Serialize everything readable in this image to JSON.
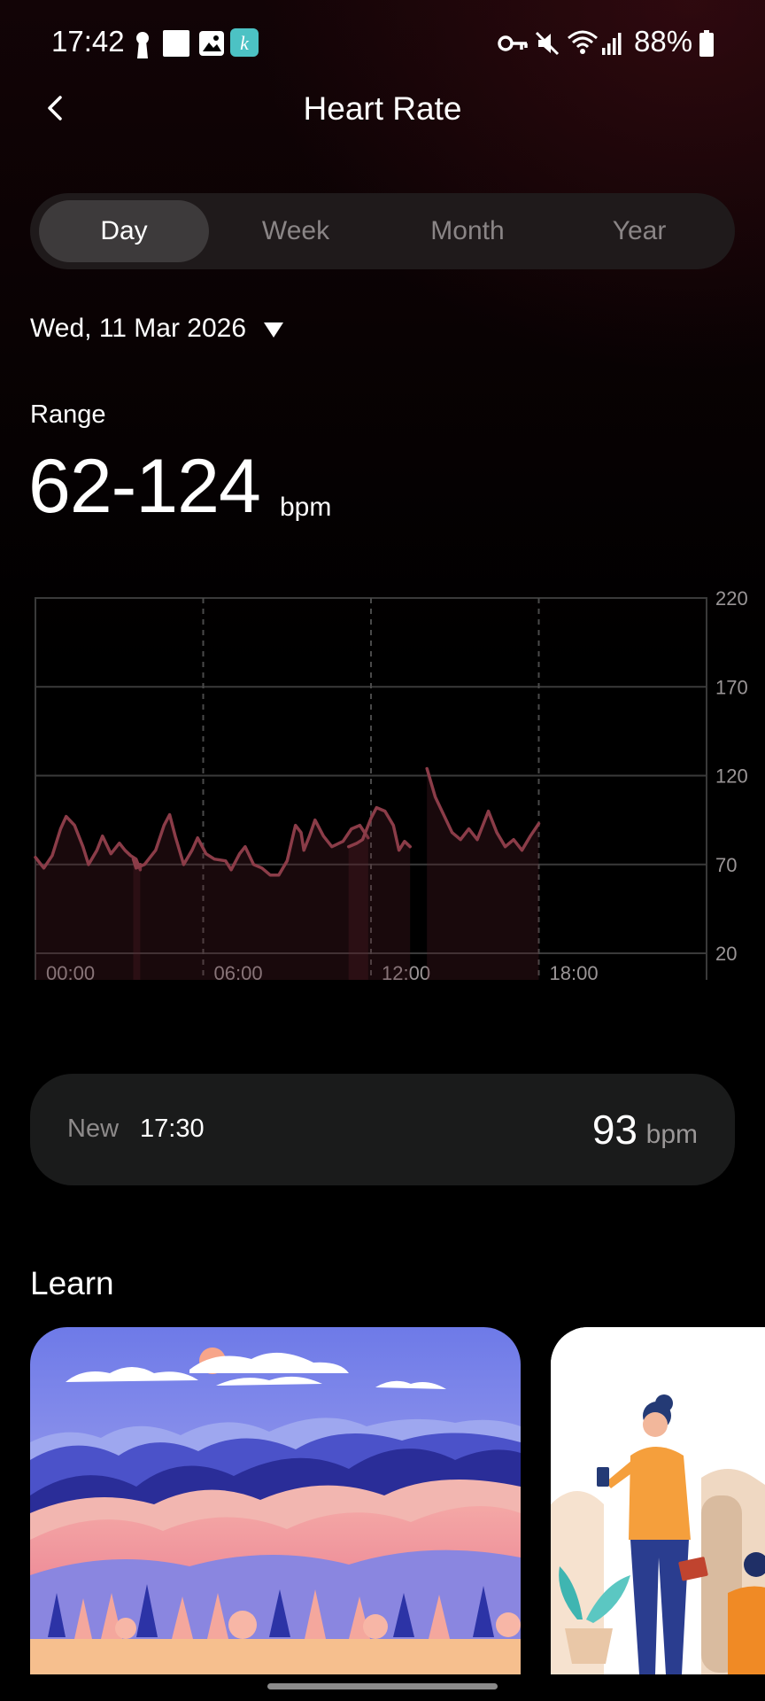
{
  "status_bar": {
    "time": "17:42",
    "battery_percent": "88%",
    "icons": [
      "vpn-key-icon",
      "mute-icon",
      "wifi-icon",
      "signal-icon",
      "battery-icon"
    ]
  },
  "header": {
    "title": "Heart Rate",
    "back_icon": "chevron-left-icon"
  },
  "tabs": [
    {
      "label": "Day",
      "active": true
    },
    {
      "label": "Week",
      "active": false
    },
    {
      "label": "Month",
      "active": false
    },
    {
      "label": "Year",
      "active": false
    }
  ],
  "date": {
    "label": "Wed, 11 Mar 2026"
  },
  "range": {
    "label": "Range",
    "value": "62-124",
    "unit": "bpm"
  },
  "chart_data": {
    "type": "line",
    "y_ticks": [
      "220",
      "170",
      "120",
      "70",
      "20"
    ],
    "ylim": [
      20,
      220
    ],
    "x_ticks": [
      "00:00",
      "06:00",
      "12:00",
      "18:00"
    ],
    "xlim": [
      0,
      24
    ],
    "grid": true,
    "line_color": "#8b3c48",
    "segments": [
      [
        [
          0,
          74
        ],
        [
          0.3,
          68
        ],
        [
          0.6,
          75
        ],
        [
          0.9,
          90
        ],
        [
          1.1,
          97
        ],
        [
          1.4,
          92
        ],
        [
          1.7,
          80
        ],
        [
          1.9,
          70
        ],
        [
          2.2,
          78
        ],
        [
          2.4,
          86
        ],
        [
          2.7,
          76
        ],
        [
          3.0,
          82
        ],
        [
          3.2,
          78
        ],
        [
          3.4,
          75
        ],
        [
          3.6,
          73
        ],
        [
          3.75,
          67
        ],
        [
          3.75,
          70
        ]
      ],
      [
        [
          3.5,
          73
        ],
        [
          3.6,
          68
        ],
        [
          3.9,
          70
        ],
        [
          4.3,
          78
        ],
        [
          4.6,
          92
        ],
        [
          4.8,
          98
        ],
        [
          5.0,
          86
        ],
        [
          5.3,
          70
        ],
        [
          5.6,
          78
        ],
        [
          5.8,
          85
        ],
        [
          6.1,
          76
        ],
        [
          6.4,
          73
        ],
        [
          6.8,
          72
        ],
        [
          7.0,
          67
        ],
        [
          7.3,
          76
        ],
        [
          7.5,
          80
        ],
        [
          7.8,
          70
        ],
        [
          8.1,
          68
        ],
        [
          8.4,
          64
        ],
        [
          8.7,
          64
        ],
        [
          9.0,
          72
        ],
        [
          9.3,
          92
        ],
        [
          9.5,
          88
        ],
        [
          9.6,
          78
        ],
        [
          9.8,
          86
        ],
        [
          10.0,
          95
        ],
        [
          10.3,
          86
        ],
        [
          10.6,
          80
        ],
        [
          11.0,
          83
        ],
        [
          11.3,
          90
        ],
        [
          11.6,
          92
        ],
        [
          11.9,
          85
        ]
      ],
      [
        [
          11.2,
          80
        ],
        [
          11.5,
          82
        ],
        [
          11.7,
          84
        ],
        [
          12.0,
          96
        ],
        [
          12.2,
          102
        ],
        [
          12.5,
          100
        ],
        [
          12.8,
          92
        ],
        [
          13.0,
          78
        ],
        [
          13.2,
          83
        ],
        [
          13.4,
          80
        ]
      ],
      [
        [
          14.0,
          124
        ],
        [
          14.3,
          108
        ],
        [
          14.6,
          98
        ],
        [
          14.9,
          88
        ],
        [
          15.2,
          84
        ],
        [
          15.5,
          90
        ],
        [
          15.8,
          84
        ],
        [
          16.0,
          92
        ],
        [
          16.2,
          100
        ],
        [
          16.5,
          88
        ],
        [
          16.8,
          80
        ],
        [
          17.1,
          84
        ],
        [
          17.4,
          78
        ],
        [
          17.7,
          86
        ],
        [
          18.0,
          93
        ]
      ]
    ]
  },
  "latest": {
    "label": "New",
    "time": "17:30",
    "value": "93",
    "unit": "bpm"
  },
  "learn": {
    "title": "Learn"
  }
}
